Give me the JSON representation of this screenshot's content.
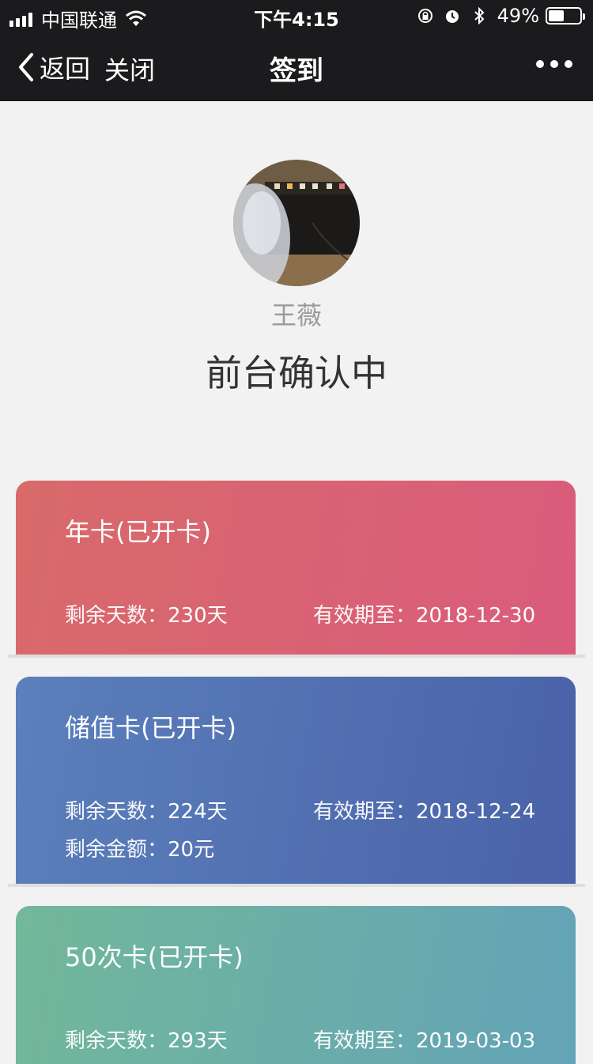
{
  "status_bar": {
    "carrier": "中国联通",
    "time": "下午4:15",
    "battery_percent": "49%",
    "battery_level": 0.49,
    "icons": [
      "signal-icon",
      "wifi-icon",
      "rotation-lock-icon",
      "alarm-icon",
      "bluetooth-icon",
      "battery-icon"
    ]
  },
  "nav": {
    "back_label": "返回",
    "close_label": "关闭",
    "title": "签到",
    "more_icon": "more-dots-icon"
  },
  "profile": {
    "name": "王薇",
    "status": "前台确认中"
  },
  "cards": [
    {
      "title": "年卡(已开卡)",
      "remaining_days_label": "剩余天数：",
      "remaining_days": "230天",
      "valid_until_label": "有效期至：",
      "valid_until": "2018-12-30",
      "color": "#d9646f"
    },
    {
      "title": "储值卡(已开卡)",
      "remaining_days_label": "剩余天数：",
      "remaining_days": "224天",
      "valid_until_label": "有效期至：",
      "valid_until": "2018-12-24",
      "balance_label": "剩余金额：",
      "balance": "20元",
      "color": "#5270b1"
    },
    {
      "title": "50次卡(已开卡)",
      "remaining_days_label": "剩余天数：",
      "remaining_days": "293天",
      "valid_until_label": "有效期至：",
      "valid_until": "2019-03-03",
      "color": "#6aadab"
    }
  ]
}
